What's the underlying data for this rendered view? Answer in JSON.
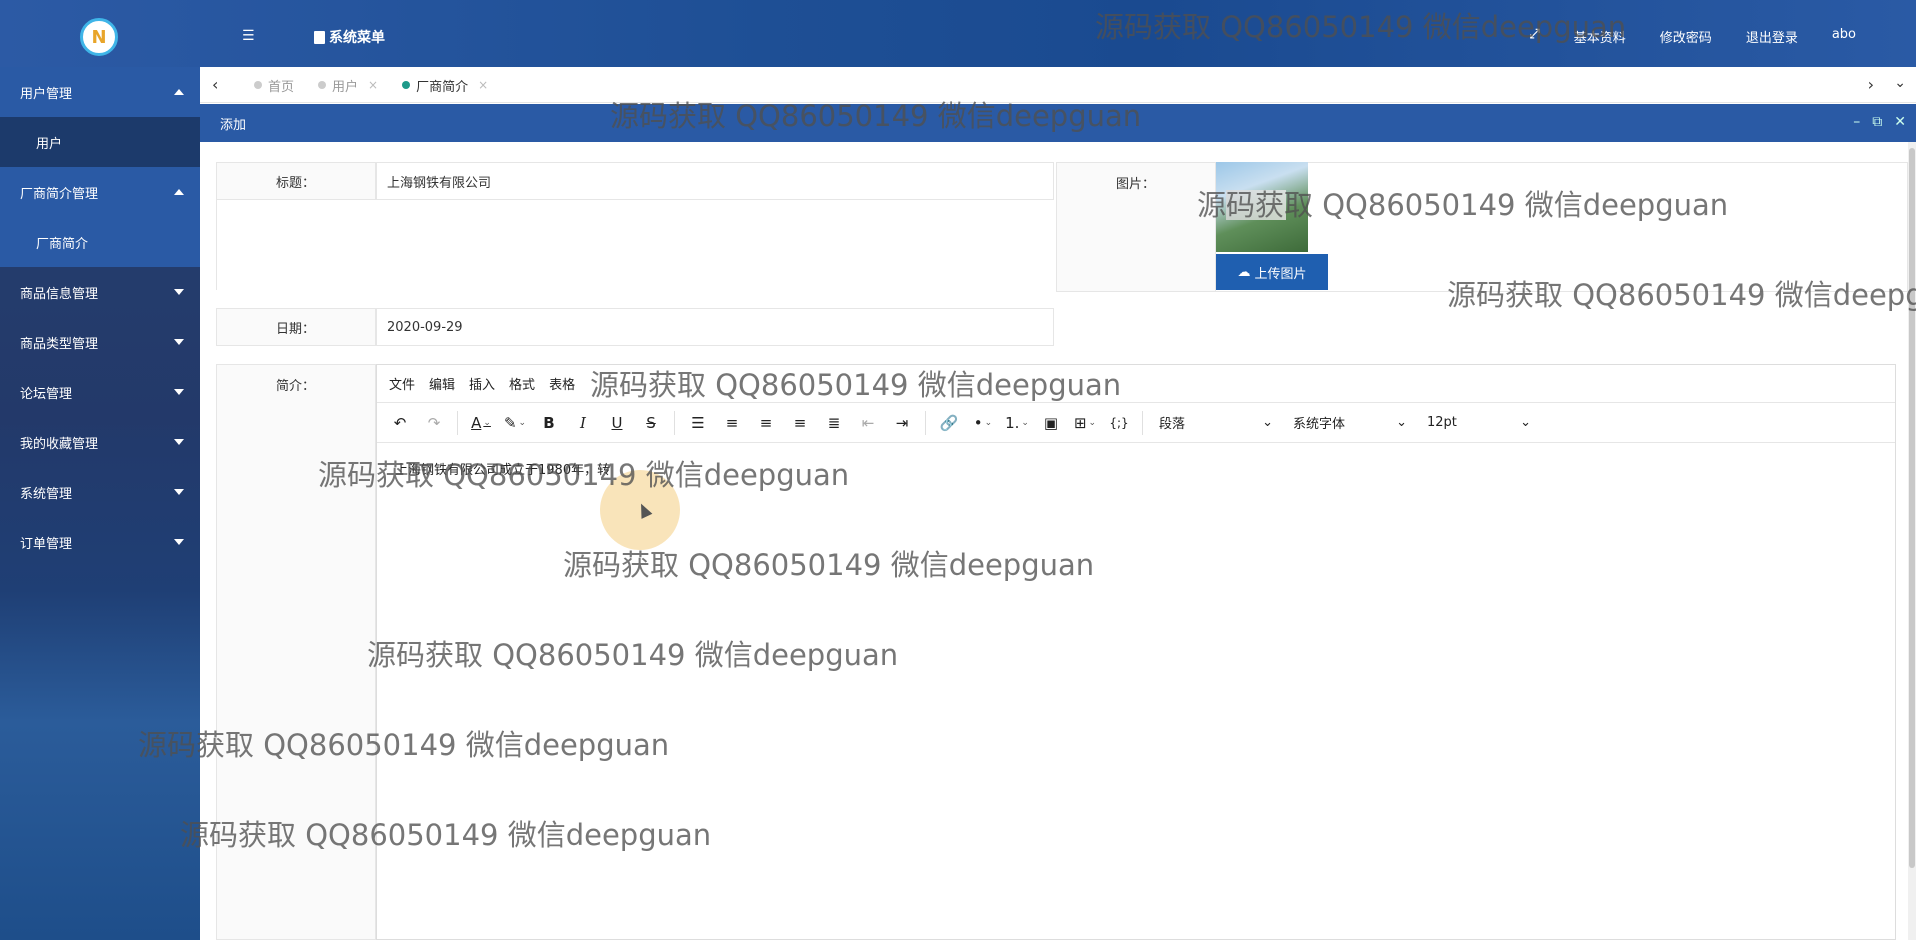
{
  "header": {
    "menu_toggle_icon": "menu-icon",
    "system_menu": "系统菜单",
    "fullscreen_icon": "expand-icon",
    "basic_info": "基本资料",
    "change_password": "修改密码",
    "logout": "退出登录",
    "user": "abo"
  },
  "sidebar": {
    "items": [
      {
        "label": "用户管理",
        "expanded": true,
        "children": [
          "用户"
        ]
      },
      {
        "label": "厂商简介管理",
        "expanded": true,
        "children": [
          "厂商简介"
        ]
      },
      {
        "label": "商品信息管理"
      },
      {
        "label": "商品类型管理"
      },
      {
        "label": "论坛管理"
      },
      {
        "label": "我的收藏管理"
      },
      {
        "label": "系统管理"
      },
      {
        "label": "订单管理"
      }
    ]
  },
  "tabs": [
    {
      "label": "首页",
      "active": false
    },
    {
      "label": "用户",
      "active": false
    },
    {
      "label": "厂商简介",
      "active": true
    }
  ],
  "panel": {
    "title": "添加"
  },
  "form": {
    "title_label": "标题：",
    "title_value": "上海钢铁有限公司",
    "image_label": "图片：",
    "upload_button": "上传图片",
    "date_label": "日期：",
    "date_value": "2020-09-29",
    "intro_label": "简介："
  },
  "editor": {
    "menus": [
      "文件",
      "编辑",
      "插入",
      "格式",
      "表格"
    ],
    "block_format": "段落",
    "font_family": "系统字体",
    "font_size": "12pt",
    "content": "上海钢铁有限公司成立于1980年，转"
  },
  "watermark": "源码获取 QQ86050149 微信deepguan"
}
